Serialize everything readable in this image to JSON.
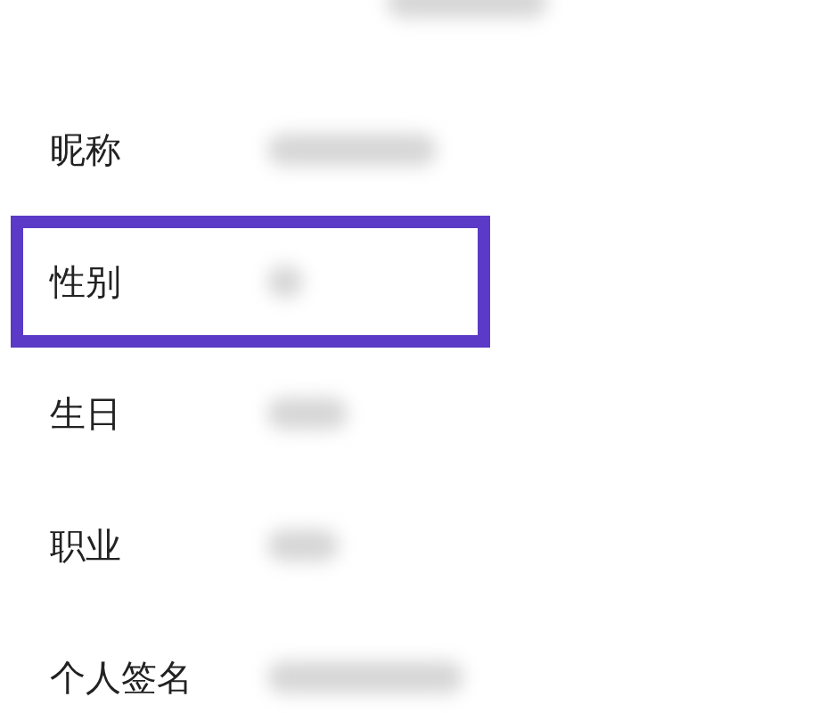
{
  "rows": [
    {
      "label": "昵称",
      "highlighted": false
    },
    {
      "label": "性别",
      "highlighted": true
    },
    {
      "label": "生日",
      "highlighted": false
    },
    {
      "label": "职业",
      "highlighted": false
    },
    {
      "label": "个人签名",
      "highlighted": false
    }
  ]
}
